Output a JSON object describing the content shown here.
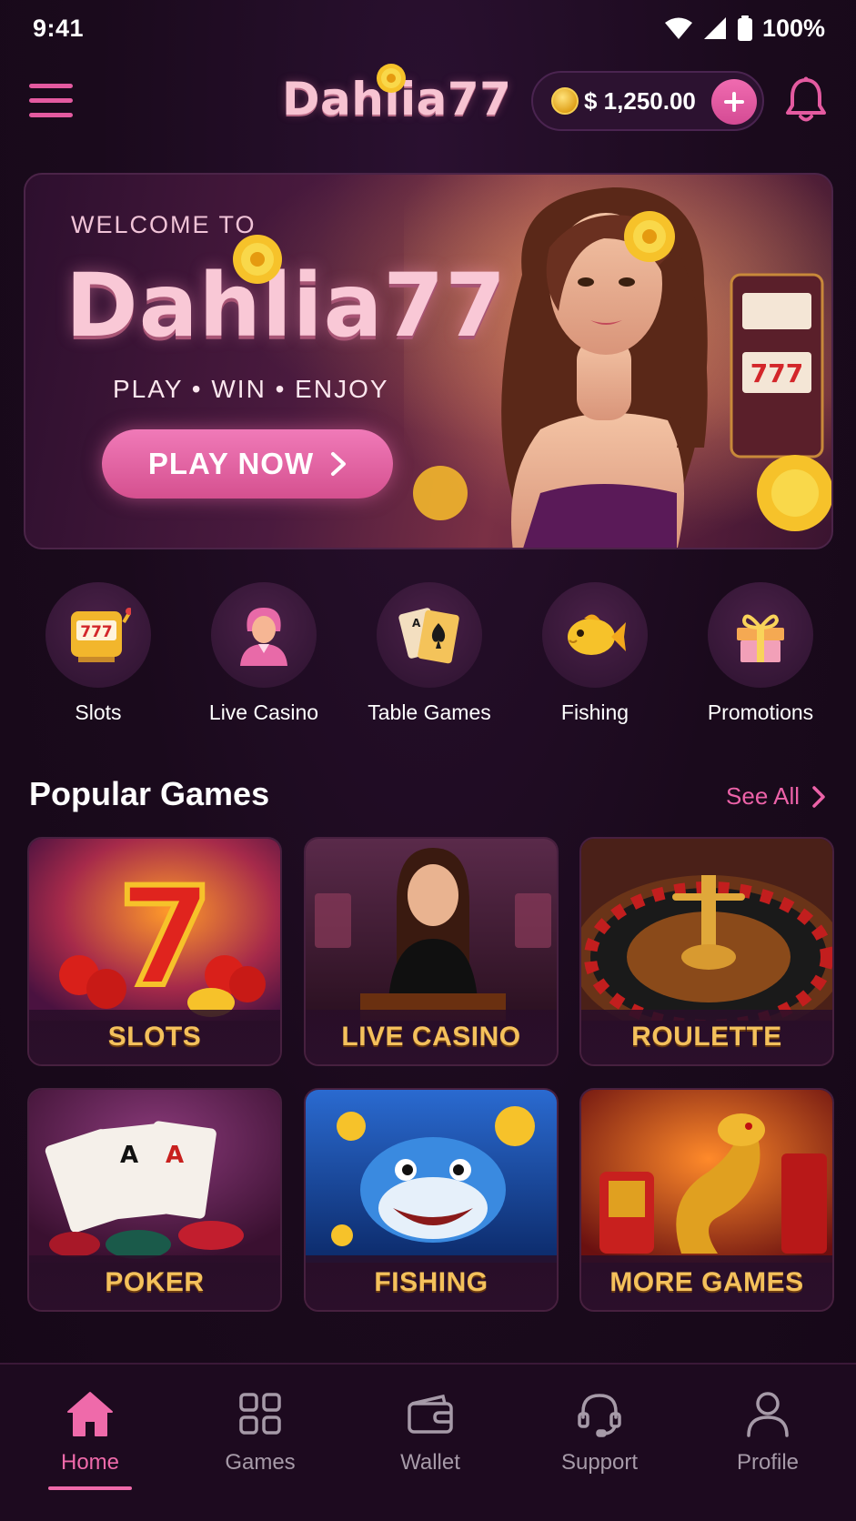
{
  "status_bar": {
    "time": "9:41",
    "battery": "100%"
  },
  "header": {
    "logo": "Dahlia77",
    "balance": "$ 1,250.00"
  },
  "hero": {
    "welcome": "WELCOME TO",
    "title": "Dahlia77",
    "tagline": "PLAY • WIN • ENJOY",
    "cta": "PLAY NOW"
  },
  "categories": [
    {
      "label": "Slots",
      "icon": "slot-machine-icon"
    },
    {
      "label": "Live Casino",
      "icon": "dealer-icon"
    },
    {
      "label": "Table Games",
      "icon": "playing-cards-icon"
    },
    {
      "label": "Fishing",
      "icon": "fish-icon"
    },
    {
      "label": "Promotions",
      "icon": "gift-icon"
    }
  ],
  "popular": {
    "title": "Popular Games",
    "see_all": "See All",
    "games": [
      {
        "label": "SLOTS"
      },
      {
        "label": "LIVE CASINO"
      },
      {
        "label": "ROULETTE"
      },
      {
        "label": "POKER"
      },
      {
        "label": "FISHING"
      },
      {
        "label": "MORE GAMES"
      }
    ]
  },
  "bottom_nav": [
    {
      "label": "Home",
      "active": true
    },
    {
      "label": "Games"
    },
    {
      "label": "Wallet"
    },
    {
      "label": "Support"
    },
    {
      "label": "Profile"
    }
  ],
  "colors": {
    "accent": "#ec62a8",
    "background": "#1c0a1e",
    "gold": "#f4c15c"
  }
}
